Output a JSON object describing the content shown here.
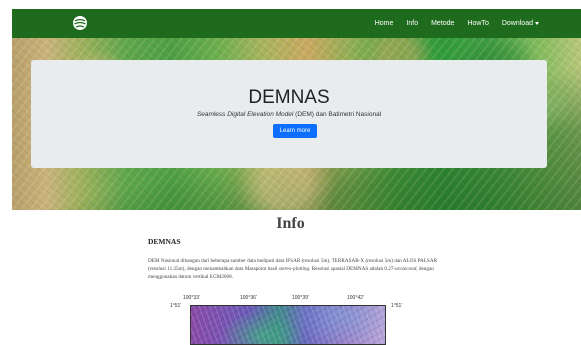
{
  "navbar": {
    "brand_icon": "globe-logo-icon",
    "items": [
      {
        "label": "Home"
      },
      {
        "label": "Info"
      },
      {
        "label": "Metode"
      },
      {
        "label": "HowTo"
      },
      {
        "label": "Download"
      }
    ],
    "bg_color": "#1e6b1e"
  },
  "hero": {
    "title": "DEMNAS",
    "subtitle_italic": "Seamless Digital Elevation Model",
    "subtitle_rest": " (DEM) dan Batimetri Nasional",
    "button_label": "Learn more",
    "button_color": "#0d6efd"
  },
  "info": {
    "title": "Info",
    "heading": "DEMNAS",
    "para_1": "DEM Nasional dibangun dari beberapa sumber data meliputi data IFSAR (resolusi 5m), TERRASAR-X (resolusi 5m) dan ALOS PALSAR (resolusi 11.25m), dengan menambahkan data Masspoint hasil ",
    "para_italic_1": "stereo-plotting",
    "para_2": ". Resolusi spasial DEMNAS adalah 0.27-",
    "para_italic_2": "arcsecond",
    "para_3": ", dengan menggunakan datum vertikal EGM2008."
  },
  "map": {
    "lon_ticks": [
      "100°33'",
      "100°36'",
      "100°39'",
      "100°42'"
    ],
    "lat_left": "1°51'",
    "lat_right": "1°51'"
  }
}
